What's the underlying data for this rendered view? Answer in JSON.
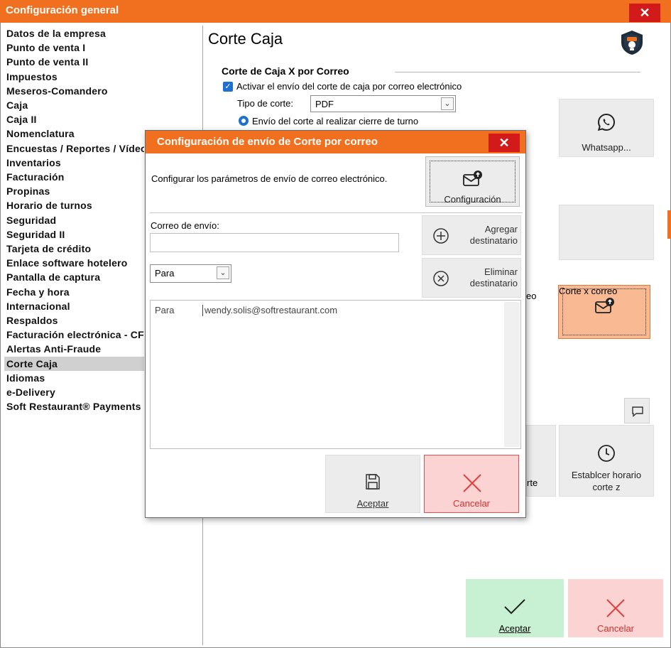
{
  "window": {
    "title": "Configuración general",
    "close_glyph": "✕"
  },
  "sidebar": {
    "items": [
      "Datos de la empresa",
      "Punto de venta I",
      "Punto de venta II",
      "Impuestos",
      "Meseros-Comandero",
      "Caja",
      "Caja II",
      "Nomenclatura",
      "Encuestas / Reportes / Vídeos",
      "Inventarios",
      "Facturación",
      "Propinas",
      "Horario de turnos",
      "Seguridad",
      "Seguridad II",
      "Tarjeta de crédito",
      "Enlace software hotelero",
      "Pantalla de captura",
      "Fecha y hora",
      "Internacional",
      "Respaldos",
      "Facturación electrónica - CFDI",
      "Alertas Anti-Fraude",
      "Corte Caja",
      "Idiomas",
      "e-Delivery",
      "Soft Restaurant® Payments"
    ],
    "selected_index": 23
  },
  "main": {
    "title": "Corte Caja",
    "section_title": "Corte de Caja X por Correo",
    "enable_email_label": "Activar el envío del corte de caja por correo electrónico",
    "enable_email_checked": true,
    "cut_type_label": "Tipo de corte:",
    "cut_type_value": "PDF",
    "radio_shift_close_label": "Envío del corte al realizar cierre de turno",
    "partial_label_fragment": "eo",
    "partial_button_fragment": "rte",
    "whatsapp_label": "Whatsapp...",
    "corte_correo_label": "Corte x correo",
    "schedule_label_line1": "Establcer horario",
    "schedule_label_line2": "corte z",
    "accept_label": "Aceptar",
    "cancel_label": "Cancelar"
  },
  "dialog": {
    "title": "Configuración de envío de Corte por correo",
    "close_glyph": "✕",
    "description": "Configurar los parámetros de envío de correo electrónico.",
    "config_button_label": "Configuración",
    "sender_label": "Correo de envío:",
    "sender_value": "",
    "add_recipient_line1": "Agregar",
    "add_recipient_line2": "destinatario",
    "remove_recipient_line1": "Eliminar",
    "remove_recipient_line2": "destinatario",
    "recipient_type_value": "Para",
    "recipients": [
      {
        "type": "Para",
        "email": "wendy.solis@softrestaurant.com"
      }
    ],
    "accept_label": "Aceptar",
    "cancel_label": "Cancelar"
  },
  "colors": {
    "titlebar": "#f07020",
    "close": "#d21a1a",
    "accept_bg": "#c8f1d4",
    "cancel_bg": "#fbd3d3",
    "cancel_icon": "#e04040",
    "checkbox": "#1e6fd0"
  }
}
